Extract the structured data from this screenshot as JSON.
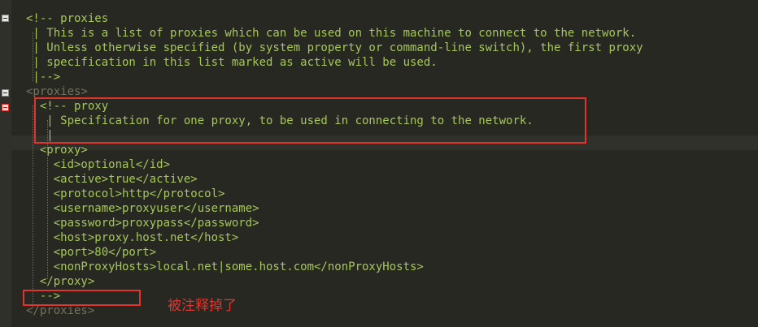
{
  "lines": [
    "<!-- proxies",
    " | This is a list of proxies which can be used on this machine to connect to the network.",
    " | Unless otherwise specified (by system property or command-line switch), the first proxy",
    " | specification in this list marked as active will be used.",
    " |-->",
    "<proxies>",
    "  <!-- proxy",
    "   | Specification for one proxy, to be used in connecting to the network.",
    "   |",
    "  <proxy>",
    "    <id>optional</id>",
    "    <active>true</active>",
    "    <protocol>http</protocol>",
    "    <username>proxyuser</username>",
    "    <password>proxypass</password>",
    "    <host>proxy.host.net</host>",
    "    <port>80</port>",
    "    <nonProxyHosts>local.net|some.host.com</nonProxyHosts>",
    "  </proxy>",
    "  -->",
    "</proxies>"
  ],
  "annotation": {
    "note": "被注释掉了"
  },
  "colors": {
    "background": "#272822",
    "comment": "#a6c75a",
    "highlight_box": "#e0342c"
  }
}
